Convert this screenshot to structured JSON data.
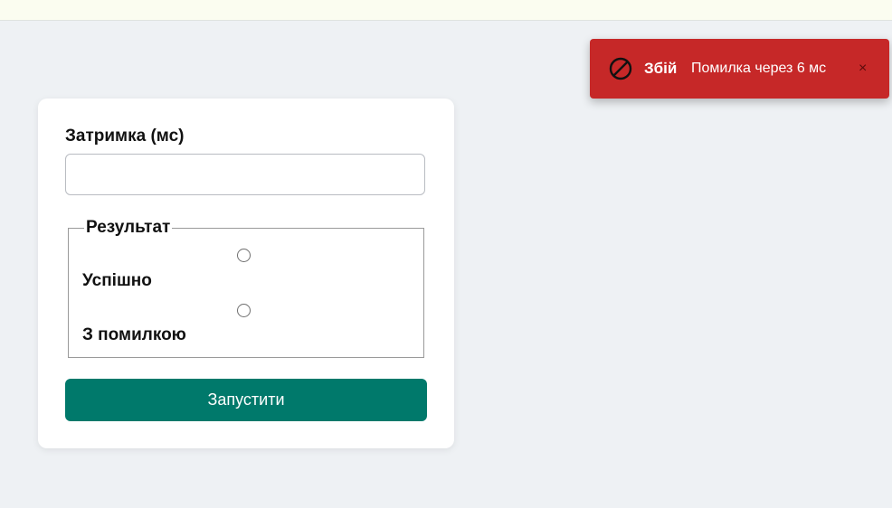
{
  "form": {
    "delay_label": "Затримка (мс)",
    "delay_value": "",
    "result_legend": "Результат",
    "options": [
      {
        "label": "Успішно",
        "checked": false
      },
      {
        "label": "З помилкою",
        "checked": false
      }
    ],
    "run_button_label": "Запустити"
  },
  "toast": {
    "icon": "ban-icon",
    "title": "Збій",
    "message": "Помилка через 6 мс",
    "close_label": "×",
    "color": "#c62828"
  },
  "colors": {
    "accent": "#00796b",
    "background": "#eef1f4",
    "error": "#c62828"
  }
}
